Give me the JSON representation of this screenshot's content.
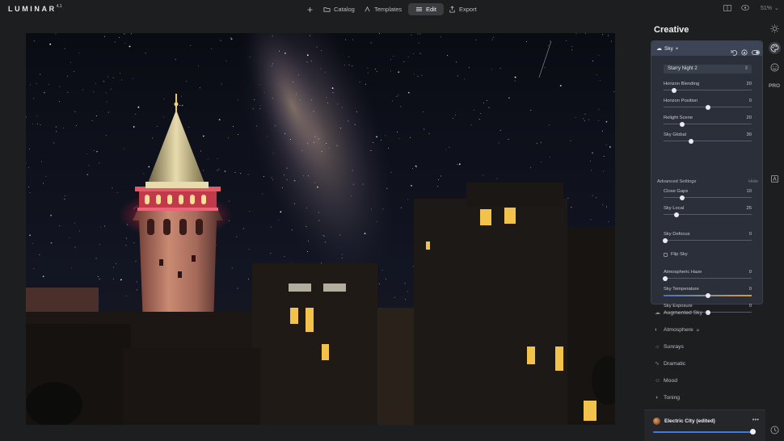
{
  "app": {
    "logo": "LUMINAR",
    "version": "4.1"
  },
  "topbar": {
    "catalog": "Catalog",
    "templates": "Templates",
    "edit": "Edit",
    "export": "Export",
    "zoom": "51%"
  },
  "panel": {
    "title": "Creative",
    "sky_card": {
      "title": "Sky",
      "title_badge": "AI",
      "sky_select": "Starry Night 2",
      "sliders": [
        {
          "label": "Horizon Blending",
          "value": "20",
          "pos": 0.12
        },
        {
          "label": "Horizon Position",
          "value": "0",
          "pos": 0.5
        },
        {
          "label": "Relight Scene",
          "value": "20",
          "pos": 0.21
        },
        {
          "label": "Sky Global",
          "value": "30",
          "pos": 0.31
        }
      ],
      "advanced_label": "Advanced Settings",
      "hide_label": "Hide",
      "adv_sliders": [
        {
          "label": "Close Gaps",
          "value": "10",
          "pos": 0.21
        },
        {
          "label": "Sky Local",
          "value": "25",
          "pos": 0.15
        },
        {
          "label": "Sky Defocus",
          "value": "0",
          "pos": 0.02
        }
      ],
      "flip_sky": "Flip Sky",
      "bottom_sliders": [
        {
          "label": "Atmospheric Haze",
          "value": "0",
          "pos": 0.02
        },
        {
          "label": "Sky Temperature",
          "value": "0",
          "pos": 0.5
        },
        {
          "label": "Sky Exposure",
          "value": "0",
          "pos": 0.5
        }
      ]
    },
    "tools": [
      {
        "label": "Augmented Sky",
        "badge": "AI"
      },
      {
        "label": "Atmosphere",
        "badge": "AI"
      },
      {
        "label": "Sunrays"
      },
      {
        "label": "Dramatic"
      },
      {
        "label": "Mood"
      },
      {
        "label": "Toning"
      }
    ],
    "preset": {
      "name": "Electric City (edited)",
      "amount": 0.97
    }
  },
  "rail": {
    "pro_label": "PRO"
  },
  "colors": {
    "accent": "#3e7be0",
    "card": "#2b2f3a",
    "background": "#1d1e20"
  }
}
